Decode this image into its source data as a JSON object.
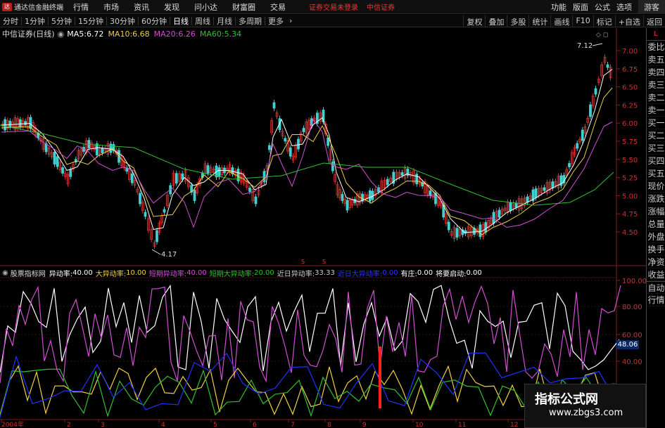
{
  "app": {
    "title": "通达信金融终端",
    "logo": "app-logo-icon",
    "menu": [
      "行情",
      "市场",
      "资讯",
      "发现",
      "问小达",
      "财富圈",
      "交易"
    ],
    "warning": "证券交易未登录",
    "warning2": "中信证券",
    "right_menu": [
      "功能",
      "版面",
      "公式",
      "选项"
    ],
    "guest": "游客"
  },
  "toolbar": {
    "items": [
      "分时",
      "1分钟",
      "5分钟",
      "15分钟",
      "30分钟",
      "60分钟",
      "日线",
      "周线",
      "月线",
      "多周期",
      "更多"
    ],
    "active": "日线",
    "right": [
      "复权",
      "叠加",
      "多股",
      "统计",
      "画线",
      "F10",
      "标记",
      "+自选",
      "返回"
    ]
  },
  "chart": {
    "stock": "中信证券(日线)",
    "ma": [
      {
        "label": "MA5:",
        "value": "6.72",
        "color": "#ffffff"
      },
      {
        "label": "MA10:",
        "value": "6.68",
        "color": "#f0d040"
      },
      {
        "label": "MA20:",
        "value": "6.26",
        "color": "#d050d0"
      },
      {
        "label": "MA60:",
        "value": "5.34",
        "color": "#30c030"
      }
    ],
    "price_axis": [
      "7.00",
      "6.75",
      "6.50",
      "6.25",
      "6.00",
      "5.75",
      "5.50",
      "5.25",
      "5.00",
      "4.75",
      "4.50"
    ],
    "high_label": "7.12",
    "low_label": "4.17"
  },
  "indicator": {
    "name": "股票指标网",
    "values": [
      {
        "label": "异动率:",
        "value": "40.00",
        "color": "#ffffff"
      },
      {
        "label": "大异动率:",
        "value": "10.00",
        "color": "#f0d040"
      },
      {
        "label": "短期异动率:",
        "value": "40.00",
        "color": "#d050d0"
      },
      {
        "label": "短期大异动率:",
        "value": "20.00",
        "color": "#30c030"
      },
      {
        "label": "近日异动率:",
        "value": "33.33",
        "color": "#cccccc"
      },
      {
        "label": "近日大异动率:",
        "value": "0.00",
        "color": "#3030ff"
      },
      {
        "label": "有庄:",
        "value": "0.00",
        "color": "#ffffff"
      },
      {
        "label": "将要启动:",
        "value": "0.00",
        "color": "#ffffff"
      }
    ],
    "axis": [
      "100.00",
      "80.00",
      "60.00",
      "40.00"
    ],
    "current": "48.06"
  },
  "xaxis": [
    "2004年",
    "2",
    "3",
    "4",
    "5",
    "6",
    "7",
    "8",
    "9",
    "10",
    "11",
    "12"
  ],
  "sidebar": {
    "top": "L",
    "items": [
      "委比",
      "卖五",
      "卖四",
      "卖三",
      "卖二",
      "卖一",
      "买一",
      "买二",
      "买三",
      "买四",
      "买五",
      "现价",
      "涨跌",
      "涨幅",
      "总量",
      "外盘",
      "换手",
      "净资",
      "收益",
      "自动",
      "行情"
    ]
  },
  "watermark": {
    "title": "指标公式网",
    "url": "www.zbgs3.com"
  }
}
